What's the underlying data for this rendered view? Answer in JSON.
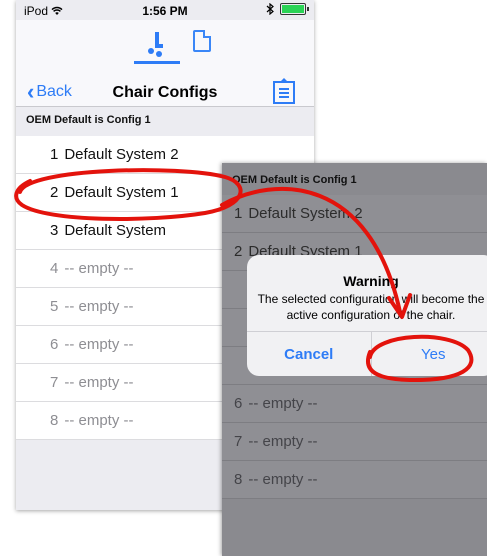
{
  "status_bar": {
    "carrier": "iPod",
    "time": "1:56 PM"
  },
  "nav": {
    "back_label": "Back",
    "title": "Chair Configs"
  },
  "section_header": "OEM Default is Config 1",
  "config_list": [
    {
      "num": "1",
      "label": "Default System 2"
    },
    {
      "num": "2",
      "label": "Default System 1"
    },
    {
      "num": "3",
      "label": "Default System"
    },
    {
      "num": "4",
      "label": "-- empty --"
    },
    {
      "num": "5",
      "label": "-- empty --"
    },
    {
      "num": "6",
      "label": "-- empty --"
    },
    {
      "num": "7",
      "label": "-- empty --"
    },
    {
      "num": "8",
      "label": "-- empty --"
    }
  ],
  "dialog_screen": {
    "section_header": "OEM Default is Config 1",
    "rows": [
      {
        "num": "1",
        "label": "Default System 2"
      },
      {
        "num": "2",
        "label": "Default System 1"
      },
      {
        "num": "6",
        "label": "-- empty --"
      },
      {
        "num": "7",
        "label": "-- empty --"
      },
      {
        "num": "8",
        "label": "-- empty --"
      }
    ]
  },
  "alert": {
    "title": "Warning",
    "message": "The selected configuration will become the active configuration of the chair.",
    "cancel_label": "Cancel",
    "confirm_label": "Yes"
  },
  "colors": {
    "accent": "#2e7cf6",
    "annotation": "#e3130c"
  },
  "icons": [
    "wifi-icon",
    "bluetooth-icon",
    "battery-icon",
    "chair-icon",
    "document-icon",
    "back-chevron-icon",
    "upload-doc-icon"
  ]
}
